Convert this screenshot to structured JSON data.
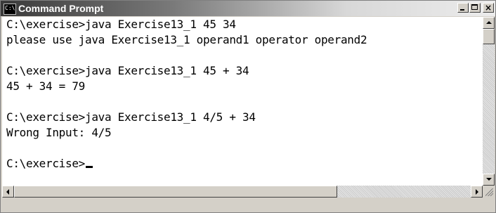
{
  "window": {
    "title": "Command Prompt",
    "icon_text": "C:\\",
    "controls": {
      "minimize": "_",
      "maximize": "□",
      "close": "×"
    }
  },
  "console": {
    "lines": [
      "C:\\exercise>java Exercise13_1 45 34",
      "please use java Exercise13_1 operand1 operator operand2",
      "",
      "C:\\exercise>java Exercise13_1 45 + 34",
      "45 + 34 = 79",
      "",
      "C:\\exercise>java Exercise13_1 4/5 + 34",
      "Wrong Input: 4/5",
      "",
      "C:\\exercise>"
    ]
  },
  "colors": {
    "console_background": "#ffffff",
    "console_text": "#000000",
    "titlebar_start": "#3a3a3a",
    "titlebar_end": "#ececec"
  }
}
